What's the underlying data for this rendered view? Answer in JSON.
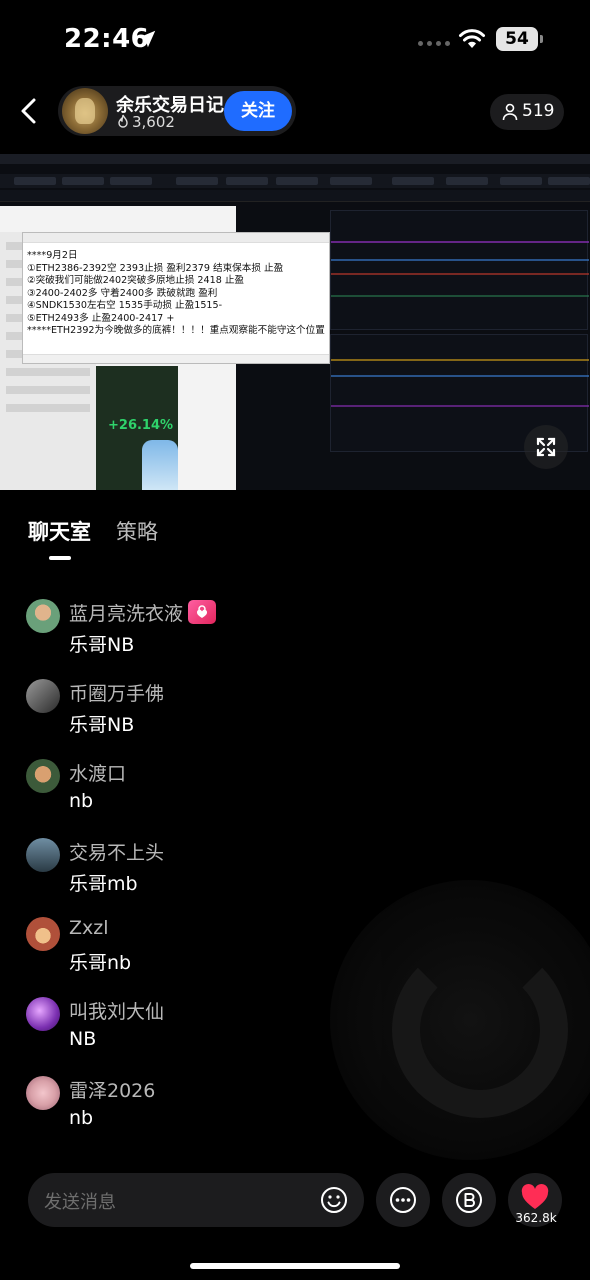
{
  "status_bar": {
    "time": "22:46",
    "battery": "54"
  },
  "header": {
    "host_name": "余乐交易日记",
    "host_heat": "3,602",
    "follow_label": "关注",
    "viewer_count": "519"
  },
  "video": {
    "notepad": {
      "lines": [
        "****9月2日",
        "①ETH2386-2392空 2393止损  盈利2379   结束保本损   止盈",
        "②突破我们可能做2402突破多原地止损  2418     止盈",
        "③2400-2402多   守着2400多 跌破就跑   盈利",
        "④SNDK1530左右空 1535手动损     止盈1515-",
        "⑤ETH2493多   止盈2400-2417 +",
        "*****ETH2392为今晚做多的底裤！！！！重点观察能不能守这个位置"
      ]
    },
    "phone_card": {
      "percent": "+26.14%"
    }
  },
  "tabs": {
    "chat": "聊天室",
    "strategy": "策略"
  },
  "messages": [
    {
      "name": "蓝月亮洗衣液",
      "text": "乐哥NB",
      "avatar_color": "#6aa07a"
    },
    {
      "name": "币圈万手佛",
      "text": "乐哥NB",
      "avatar_color": "#5a5a5a"
    },
    {
      "name": "水渡口",
      "text": "nb",
      "avatar_color": "#7a6a3a"
    },
    {
      "name": "交易不上头",
      "text": "乐哥mb",
      "avatar_color": "#3d5566"
    },
    {
      "name": "Zxzl",
      "text": "乐哥nb",
      "avatar_color": "#b0503a"
    },
    {
      "name": "叫我刘大仙",
      "text": "NB",
      "avatar_color": "#7a2fb0"
    },
    {
      "name": "雷泽2026",
      "text": "nb",
      "avatar_color": "#d8a0a8"
    }
  ],
  "bottom_bar": {
    "input_placeholder": "发送消息",
    "like_count": "362.8k"
  },
  "colors": {
    "accent_blue": "#1f6cff",
    "like_red": "#ff2d55"
  },
  "icons": [
    "back-icon",
    "fire-icon",
    "user-icon",
    "location-icon",
    "wifi-icon",
    "fullscreen-icon",
    "emoji-icon",
    "more-icon",
    "bitcoin-icon",
    "heart-icon",
    "badge-heart-icon"
  ]
}
